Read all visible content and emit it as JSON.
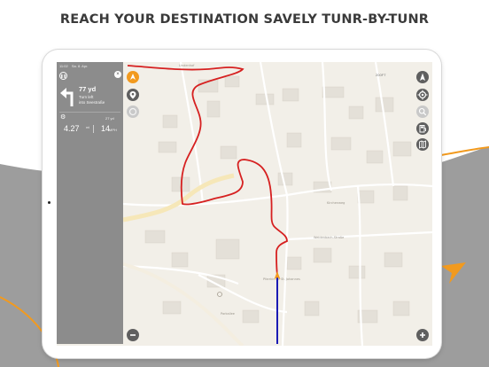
{
  "headline": "REACH YOUR DESTINATION SAVELY TUNR-BY-TUNR",
  "nav_panel": {
    "status_bar": [
      "11:02",
      "Sa. 8. Apr."
    ],
    "close_icon": "close-icon",
    "pause_icon": "pause-icon",
    "turn_icon": "turn-left-icon",
    "maneuver_distance": "77 yd",
    "instruction_line1": "Turn left",
    "instruction_line2": "into Seestraße",
    "settings_icon": "gear-icon",
    "next_distance": "27 yd",
    "total_distance": "4.27",
    "total_distance_unit": "mi",
    "speed": "14",
    "speed_unit": "MPH"
  },
  "map": {
    "scale_label": "200FT",
    "left_buttons": [
      "recenter-icon",
      "location-pin-icon",
      "zoom-out-icon"
    ],
    "right_buttons": [
      "compass-icon",
      "my-location-icon",
      "search-icon",
      "fuel-icon",
      "map-layers-icon"
    ],
    "bottom_left_button": "minus-icon",
    "bottom_right_button": "plus-icon"
  },
  "colors": {
    "route": "#d62020",
    "track": "#1a1ab4",
    "accent": "#f29a1e",
    "panel": "#8c8c8c"
  }
}
